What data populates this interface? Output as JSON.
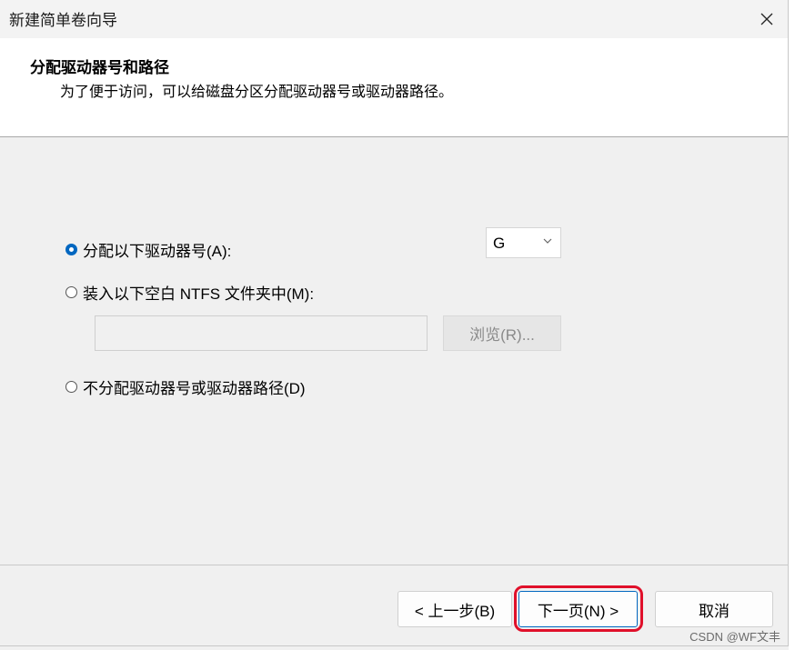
{
  "window": {
    "title": "新建简单卷向导",
    "close_label": "✕"
  },
  "header": {
    "title": "分配驱动器号和路径",
    "subtitle": "为了便于访问，可以给磁盘分区分配驱动器号或驱动器路径。"
  },
  "options": {
    "assign_letter": {
      "label": "分配以下驱动器号(A):",
      "checked": true
    },
    "mount_folder": {
      "label": "装入以下空白 NTFS 文件夹中(M):",
      "checked": false
    },
    "no_assign": {
      "label": "不分配驱动器号或驱动器路径(D)",
      "checked": false
    }
  },
  "drive_select": {
    "value": "G"
  },
  "folder_input": {
    "value": ""
  },
  "browse_button": {
    "label": "浏览(R)..."
  },
  "footer": {
    "back_label": "< 上一步(B)",
    "next_label": "下一页(N) >",
    "cancel_label": "取消"
  },
  "watermark": "CSDN @WF文丰",
  "colors": {
    "accent": "#0067c0",
    "highlight": "#e0102a"
  }
}
